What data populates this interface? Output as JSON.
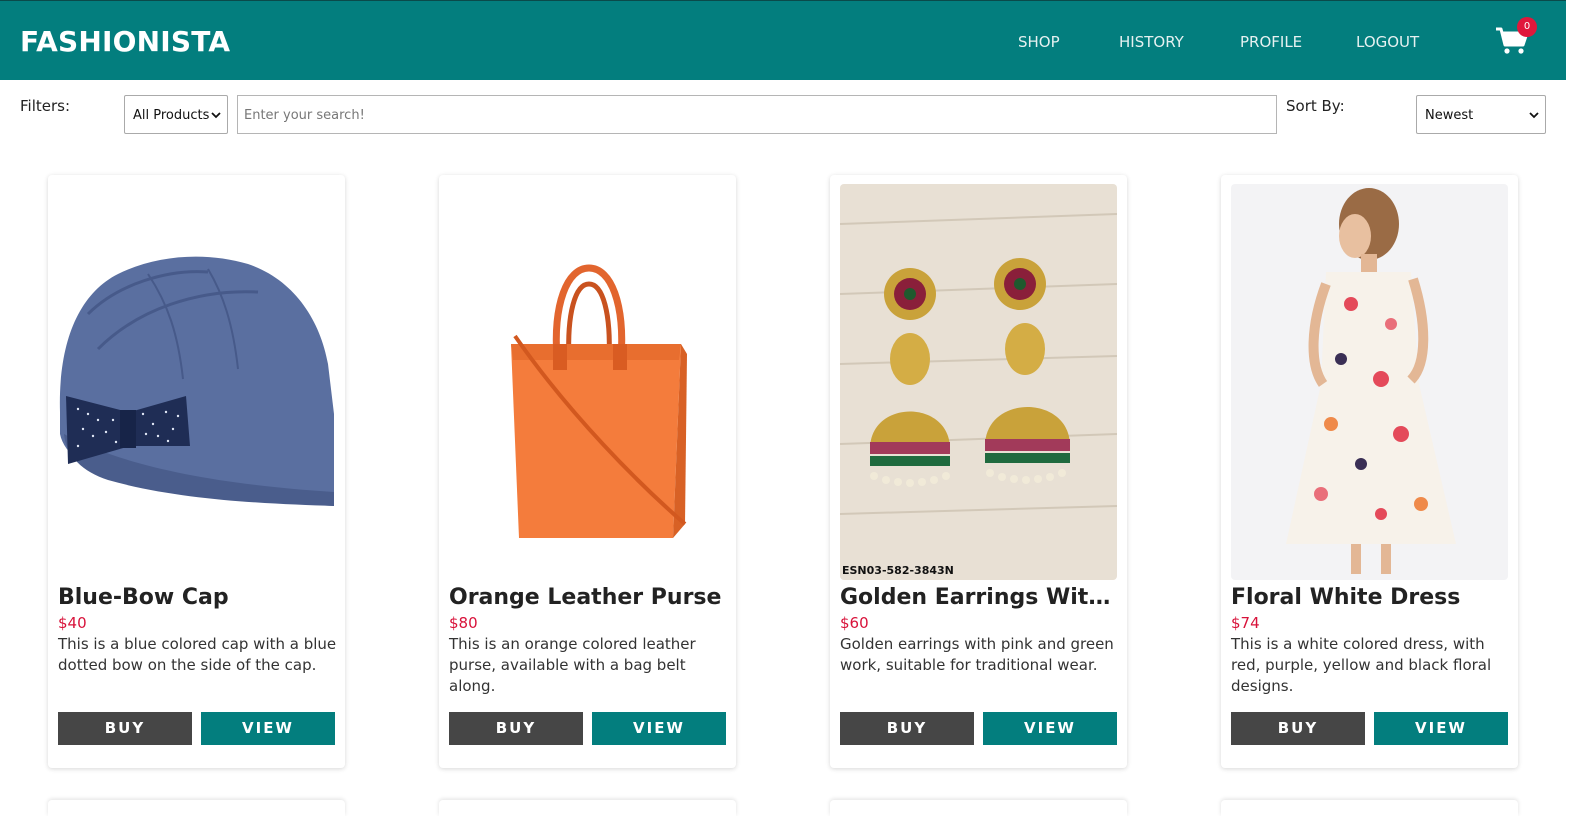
{
  "header": {
    "brand": "FASHIONISTA",
    "nav": [
      "SHOP",
      "HISTORY",
      "PROFILE",
      "LOGOUT"
    ],
    "cart_count": "0",
    "cart_icon": "cart-icon"
  },
  "filters": {
    "label": "Filters:",
    "category_selected": "All Products",
    "search_placeholder": "Enter your search!",
    "sort_label": "Sort By:",
    "sort_selected": "Newest"
  },
  "products": [
    {
      "title": "Blue-Bow Cap",
      "price": "$40",
      "description": "This is a blue colored cap with a blue dotted bow on the side of the cap.",
      "buy": "BUY",
      "view": "VIEW"
    },
    {
      "title": "Orange Leather Purse",
      "price": "$80",
      "description": "This is an orange colored leather purse, available with a bag belt along.",
      "buy": "BUY",
      "view": "VIEW"
    },
    {
      "title": "Golden Earrings With Pink and Green Work",
      "price": "$60",
      "description": "Golden earrings with pink and green work, suitable for traditional wear.",
      "image_caption": "ESN03-582-3843N",
      "buy": "BUY",
      "view": "VIEW"
    },
    {
      "title": "Floral White Dress",
      "price": "$74",
      "description": "This is a white colored dress, with red, purple, yellow and black floral designs.",
      "buy": "BUY",
      "view": "VIEW"
    }
  ],
  "colors": {
    "primary": "#037e7e",
    "buy_button": "#464646",
    "price": "#d8123a",
    "badge": "#e0173b"
  }
}
